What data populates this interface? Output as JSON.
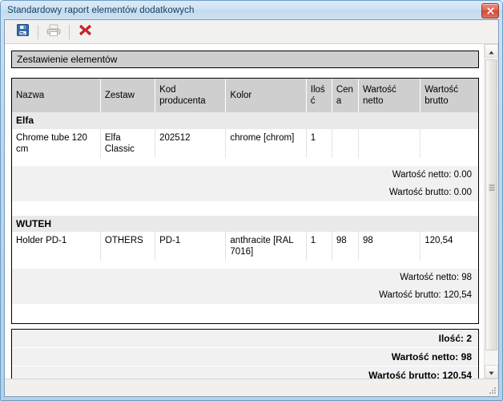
{
  "window": {
    "title": "Standardowy raport elementów dodatkowych",
    "close_label": "x",
    "accent_title_color": "#16425c",
    "close_button_color": "#cf4a3b"
  },
  "toolbar": {
    "buttons": [
      {
        "name": "save-button",
        "icon": "save-icon",
        "tooltip": "Zapisz",
        "enabled": true
      },
      {
        "name": "print-button",
        "icon": "printer-icon",
        "tooltip": "Drukuj",
        "enabled": false
      },
      {
        "name": "close-report-button",
        "icon": "red-x-icon",
        "tooltip": "Zamknij",
        "enabled": true
      }
    ]
  },
  "report": {
    "band_title": "Zestawienie elementów",
    "columns": [
      "Nazwa",
      "Zestaw",
      "Kod producenta",
      "Kolor",
      "Ilość",
      "Cena",
      "Wartość netto",
      "Wartość brutto"
    ],
    "groups": [
      {
        "name": "Elfa",
        "rows": [
          {
            "nazwa": "Chrome tube 120 cm",
            "zestaw": "Elfa Classic",
            "kod": "202512",
            "kolor": "chrome [chrom]",
            "ilosc": "1",
            "cena": "",
            "netto": "",
            "brutto": ""
          }
        ],
        "subtotals": [
          "Wartość netto: 0.00",
          "Wartość brutto: 0.00"
        ]
      },
      {
        "name": "WUTEH",
        "rows": [
          {
            "nazwa": "Holder PD-1",
            "zestaw": "OTHERS",
            "kod": "PD-1",
            "kolor": "anthracite [RAL 7016]",
            "ilosc": "1",
            "cena": "98",
            "netto": "98",
            "brutto": "120,54"
          }
        ],
        "subtotals": [
          "Wartość netto: 98",
          "Wartość brutto: 120,54"
        ]
      }
    ],
    "totals": [
      "Ilość: 2",
      "Wartość netto: 98",
      "Wartość brutto: 120,54"
    ]
  },
  "scrollbar": {
    "up_arrow": "▲",
    "down_arrow": "▼"
  }
}
